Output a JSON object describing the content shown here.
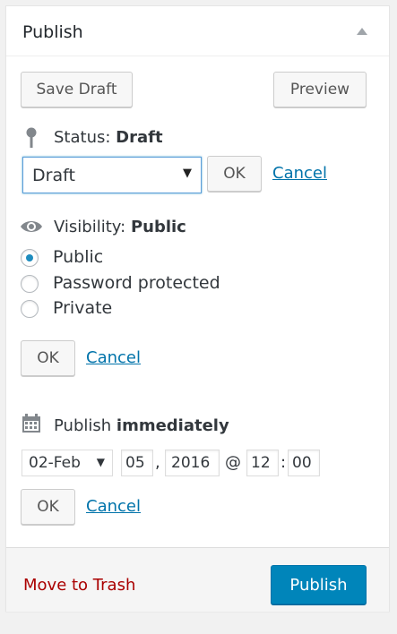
{
  "panel": {
    "title": "Publish"
  },
  "actions": {
    "save_draft": "Save Draft",
    "preview": "Preview"
  },
  "status": {
    "label": "Status:",
    "value": "Draft",
    "select_value": "Draft",
    "ok": "OK",
    "cancel": "Cancel"
  },
  "visibility": {
    "label": "Visibility:",
    "value": "Public",
    "options": [
      "Public",
      "Password protected",
      "Private"
    ],
    "selected": "Public",
    "ok": "OK",
    "cancel": "Cancel"
  },
  "schedule": {
    "label": "Publish",
    "value": "immediately",
    "month": "02-Feb",
    "day": "05",
    "comma": ",",
    "year": "2016",
    "at": "@",
    "hour": "12",
    "colon": ":",
    "minute": "00",
    "ok": "OK",
    "cancel": "Cancel"
  },
  "footer": {
    "trash": "Move to Trash",
    "publish": "Publish"
  },
  "icons": {
    "status": "pin-icon",
    "visibility": "eye-icon",
    "schedule": "calendar-icon"
  },
  "colors": {
    "accent": "#0085ba",
    "link": "#0073aa",
    "trash": "#aa0000",
    "focus": "#5b9dd9"
  }
}
